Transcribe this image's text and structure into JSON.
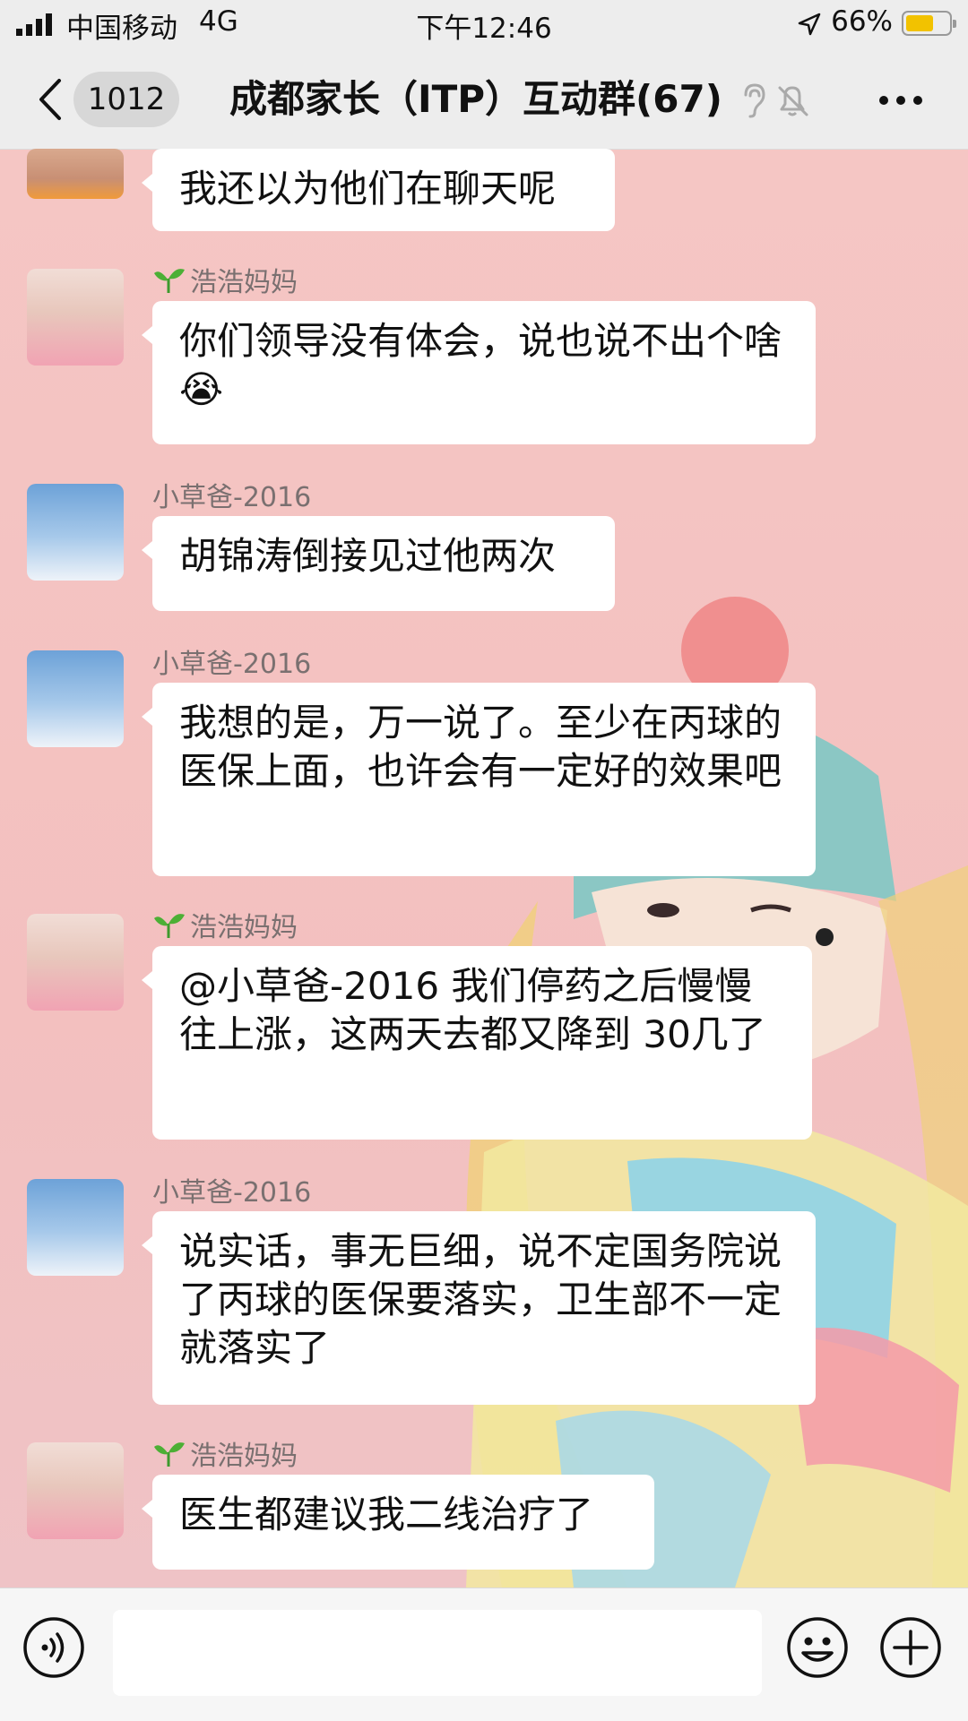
{
  "status_bar": {
    "carrier": "中国移动",
    "network": "4G",
    "time": "下午12:46",
    "battery": "66%",
    "battery_level": 0.66
  },
  "header": {
    "unread_count": "1012",
    "title": "成都家长（ITP）互动群(67)"
  },
  "messages": [
    {
      "sender": "",
      "text": "我还以为他们在聊天呢",
      "avatar": "child-avatar"
    },
    {
      "sender": "浩浩妈妈",
      "text": "你们领导没有体会，说也说不出个啥😭",
      "avatar": "girl-avatar"
    },
    {
      "sender": "小草爸-2016",
      "text": "胡锦涛倒接见过他两次",
      "avatar": "snow-tree-avatar"
    },
    {
      "sender": "小草爸-2016",
      "text": "我想的是，万一说了。至少在丙球的医保上面，也许会有一定好的效果吧",
      "avatar": "snow-tree-avatar"
    },
    {
      "sender": "浩浩妈妈",
      "text": "@小草爸-2016 我们停药之后慢慢往上涨，这两天去都又降到 30几了",
      "avatar": "girl-avatar"
    },
    {
      "sender": "小草爸-2016",
      "text": "说实话，事无巨细，说不定国务院说了丙球的医保要落实，卫生部不一定就落实了",
      "avatar": "snow-tree-avatar"
    },
    {
      "sender": "浩浩妈妈",
      "text": "医生都建议我二线治疗了",
      "avatar": "girl-avatar"
    }
  ],
  "input": {
    "placeholder": ""
  },
  "colors": {
    "bubble": "#ffffff",
    "header": "#ededed",
    "background": "#f3c4c3",
    "battery": "#f2c200"
  }
}
